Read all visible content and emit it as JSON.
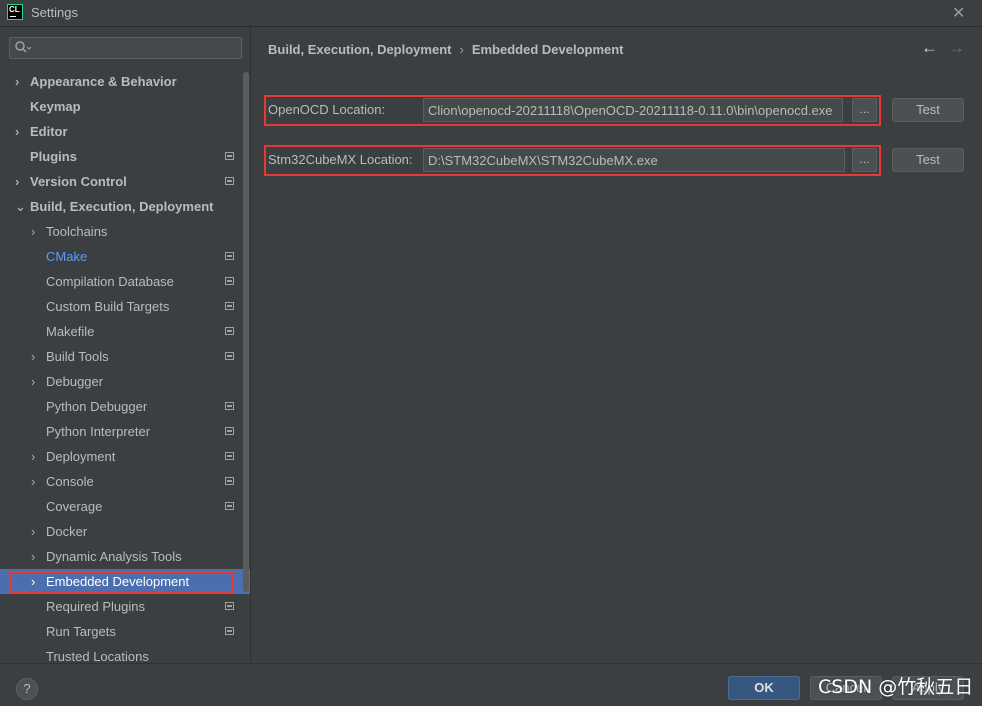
{
  "window": {
    "title": "Settings",
    "logo_text": "CL",
    "close_glyph": "✕"
  },
  "search": {
    "placeholder": "",
    "value": ""
  },
  "sidebar": {
    "items": [
      {
        "label": "Appearance & Behavior",
        "level": 0,
        "bold": true,
        "chevron": "›",
        "proj": false
      },
      {
        "label": "Keymap",
        "level": 0,
        "bold": true,
        "chevron": "",
        "proj": false
      },
      {
        "label": "Editor",
        "level": 0,
        "bold": true,
        "chevron": "›",
        "proj": false
      },
      {
        "label": "Plugins",
        "level": 0,
        "bold": true,
        "chevron": "",
        "proj": true
      },
      {
        "label": "Version Control",
        "level": 0,
        "bold": true,
        "chevron": "›",
        "proj": true
      },
      {
        "label": "Build, Execution, Deployment",
        "level": 0,
        "bold": true,
        "chevron": "⌄",
        "proj": false
      },
      {
        "label": "Toolchains",
        "level": 1,
        "bold": false,
        "chevron": "›",
        "proj": false
      },
      {
        "label": "CMake",
        "level": 1,
        "bold": false,
        "chevron": "",
        "proj": true,
        "link": true
      },
      {
        "label": "Compilation Database",
        "level": 1,
        "bold": false,
        "chevron": "",
        "proj": true
      },
      {
        "label": "Custom Build Targets",
        "level": 1,
        "bold": false,
        "chevron": "",
        "proj": true
      },
      {
        "label": "Makefile",
        "level": 1,
        "bold": false,
        "chevron": "",
        "proj": true
      },
      {
        "label": "Build Tools",
        "level": 1,
        "bold": false,
        "chevron": "›",
        "proj": true
      },
      {
        "label": "Debugger",
        "level": 1,
        "bold": false,
        "chevron": "›",
        "proj": false
      },
      {
        "label": "Python Debugger",
        "level": 1,
        "bold": false,
        "chevron": "",
        "proj": true
      },
      {
        "label": "Python Interpreter",
        "level": 1,
        "bold": false,
        "chevron": "",
        "proj": true
      },
      {
        "label": "Deployment",
        "level": 1,
        "bold": false,
        "chevron": "›",
        "proj": true
      },
      {
        "label": "Console",
        "level": 1,
        "bold": false,
        "chevron": "›",
        "proj": true
      },
      {
        "label": "Coverage",
        "level": 1,
        "bold": false,
        "chevron": "",
        "proj": true
      },
      {
        "label": "Docker",
        "level": 1,
        "bold": false,
        "chevron": "›",
        "proj": false
      },
      {
        "label": "Dynamic Analysis Tools",
        "level": 1,
        "bold": false,
        "chevron": "›",
        "proj": false
      },
      {
        "label": "Embedded Development",
        "level": 1,
        "bold": false,
        "chevron": "›",
        "proj": false,
        "selected": true
      },
      {
        "label": "Required Plugins",
        "level": 1,
        "bold": false,
        "chevron": "",
        "proj": true
      },
      {
        "label": "Run Targets",
        "level": 1,
        "bold": false,
        "chevron": "",
        "proj": true
      },
      {
        "label": "Trusted Locations",
        "level": 1,
        "bold": false,
        "chevron": "",
        "proj": false
      }
    ]
  },
  "breadcrumb": {
    "parent": "Build, Execution, Deployment",
    "separator": "›",
    "current": "Embedded Development"
  },
  "nav": {
    "back_glyph": "←",
    "forward_glyph": "→"
  },
  "openocd": {
    "label": "OpenOCD Location:",
    "value": "Clion\\openocd-20211118\\OpenOCD-20211118-0.11.0\\bin\\openocd.exe",
    "browse_label": "...",
    "test_label": "Test"
  },
  "stm32": {
    "label": "Stm32CubeMX Location:",
    "value": "D:\\STM32CubeMX\\STM32CubeMX.exe",
    "browse_label": "...",
    "test_label": "Test"
  },
  "footer": {
    "help_label": "?",
    "ok_label": "OK",
    "cancel_label": "Cancel",
    "apply_label": "Apply",
    "watermark": "CSDN @竹秋五日"
  },
  "colors": {
    "background": "#3c3f41",
    "selection": "#4b6eaf",
    "link": "#589df6",
    "highlight_box": "#e53935",
    "ok_button": "#365880"
  }
}
